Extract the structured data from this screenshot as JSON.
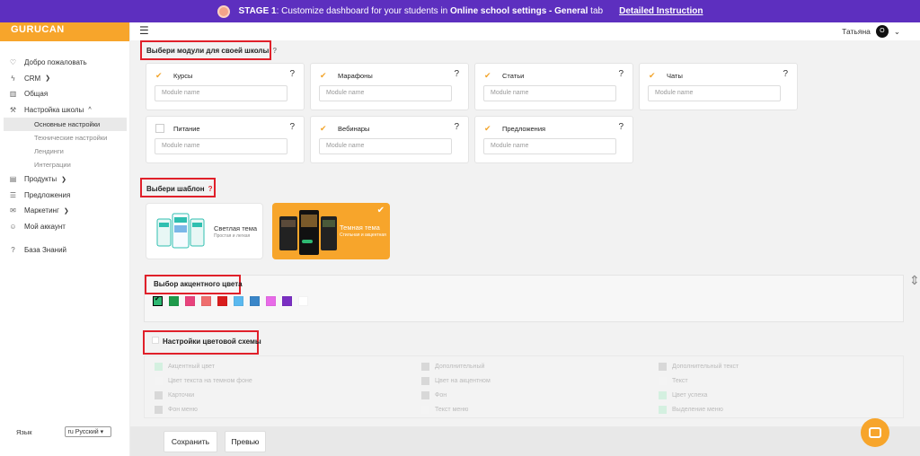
{
  "banner": {
    "stage_label": "STAGE 1",
    "text_pre": ": Customize dashboard for your students in ",
    "text_bold": "Online school settings - General",
    "text_post": " tab",
    "link": "Detailed Instruction"
  },
  "logo": "GURUCAN",
  "sidebar": {
    "items": [
      {
        "label": "Добро пожаловать",
        "icon": "heart-icon"
      },
      {
        "label": "CRM",
        "icon": "bolt-icon",
        "chevron": "chevron-down-icon"
      },
      {
        "label": "Общая",
        "icon": "bar-chart-icon"
      },
      {
        "label": "Настройка школы",
        "icon": "wrench-icon",
        "chevron": "chevron-up-icon"
      },
      {
        "label": "Продукты",
        "icon": "document-icon",
        "chevron": "chevron-down-icon"
      },
      {
        "label": "Предложения",
        "icon": "list-icon"
      },
      {
        "label": "Маркетинг",
        "icon": "mail-icon",
        "chevron": "chevron-down-icon"
      },
      {
        "label": "Мой аккаунт",
        "icon": "user-icon"
      },
      {
        "label": "База Знаний",
        "icon": "question-circle-icon"
      }
    ],
    "sub_items": [
      "Основные настройки",
      "Технические настройки",
      "Лендинги",
      "Интеграции"
    ],
    "lang_label": "Язык",
    "lang_value": "ru Русский"
  },
  "topbar": {
    "user_name": "Татьяна",
    "avatar_letter": "О"
  },
  "modules": {
    "title": "Выбери модули для своей школы",
    "help": "?",
    "placeholder": "Module name",
    "items": [
      {
        "label": "Курсы",
        "checked": true
      },
      {
        "label": "Марафоны",
        "checked": true
      },
      {
        "label": "Статьи",
        "checked": true
      },
      {
        "label": "Чаты",
        "checked": true
      },
      {
        "label": "Питание",
        "checked": false
      },
      {
        "label": "Вебинары",
        "checked": true
      },
      {
        "label": "Предложения",
        "checked": true
      }
    ]
  },
  "templates": {
    "title": "Выбери шаблон",
    "help": "?",
    "items": [
      {
        "title": "Светлая тема",
        "subtitle": "Простая и легкая",
        "selected": false
      },
      {
        "title": "Темная тема",
        "subtitle": "Стильная и акцентная",
        "selected": true
      }
    ]
  },
  "accent": {
    "title": "Выбор акцентного цвета",
    "colors": [
      "#2eb872",
      "#1e9a4a",
      "#e8437c",
      "#ef6e6e",
      "#d91d1d",
      "#5bb9ef",
      "#3a86c8",
      "#e86be8",
      "#7a2fc2",
      "#ffffff"
    ],
    "selected_index": 0
  },
  "scheme": {
    "title": "Настройки цветовой схемы",
    "items": [
      {
        "label": "Акцентный цвет",
        "color": "#d4f0e0"
      },
      {
        "label": "Цвет текста на темном фоне",
        "color": "#f4f4f4"
      },
      {
        "label": "Карточки",
        "color": "#d8d8d8"
      },
      {
        "label": "Фон меню",
        "color": "#d8d8d8"
      },
      {
        "label": "Дополнительный",
        "color": "#d8d8d8"
      },
      {
        "label": "Цвет на акцентном",
        "color": "#d8d8d8"
      },
      {
        "label": "Фон",
        "color": "#d8d8d8"
      },
      {
        "label": "Текст меню",
        "color": "#f4f4f4"
      },
      {
        "label": "Дополнительный текст",
        "color": "#d8d8d8"
      },
      {
        "label": "Текст",
        "color": "#f4f4f4"
      },
      {
        "label": "Цвет успеха",
        "color": "#d4f0e0"
      },
      {
        "label": "Выделение меню",
        "color": "#d4f0e0"
      }
    ]
  },
  "footer": {
    "save": "Сохранить",
    "preview": "Превью"
  }
}
